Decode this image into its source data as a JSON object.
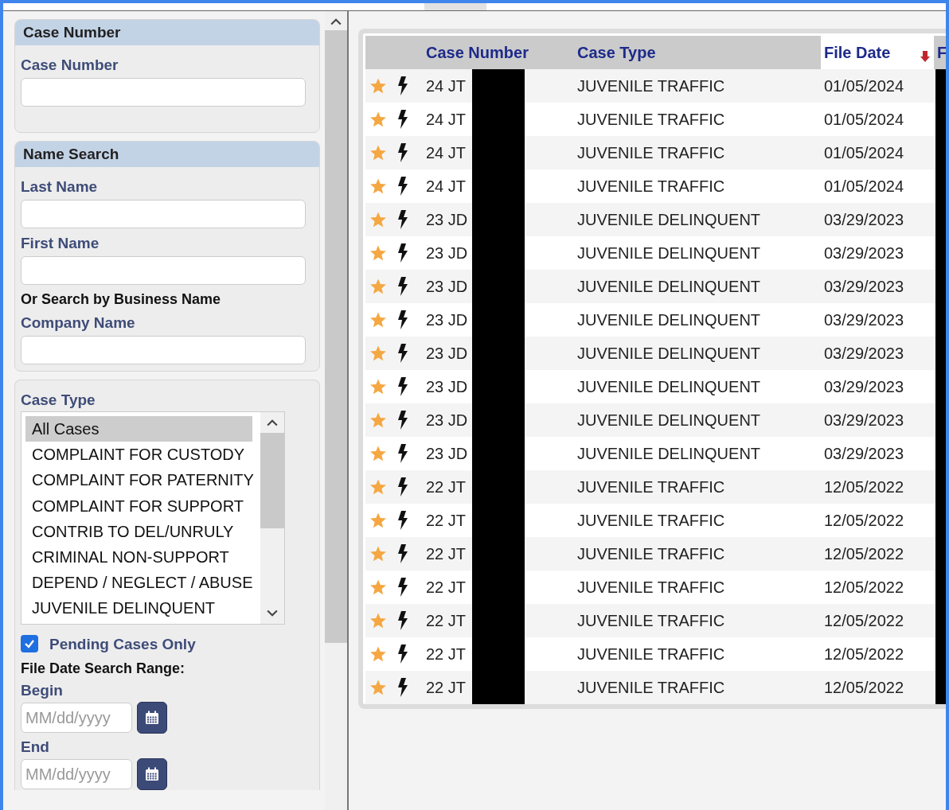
{
  "case_number_section": {
    "title": "Case Number",
    "label": "Case Number"
  },
  "name_search_section": {
    "title": "Name Search",
    "last_name_label": "Last Name",
    "first_name_label": "First Name",
    "business_heading": "Or Search by Business Name",
    "company_label": "Company Name"
  },
  "case_type_section": {
    "label": "Case Type",
    "options": [
      {
        "label": "All Cases",
        "selected": true
      },
      {
        "label": "COMPLAINT FOR CUSTODY",
        "selected": false
      },
      {
        "label": "COMPLAINT FOR PATERNITY",
        "selected": false
      },
      {
        "label": "COMPLAINT FOR SUPPORT",
        "selected": false
      },
      {
        "label": "CONTRIB TO DEL/UNRULY",
        "selected": false
      },
      {
        "label": "CRIMINAL NON-SUPPORT",
        "selected": false
      },
      {
        "label": "DEPEND / NEGLECT / ABUSE",
        "selected": false
      },
      {
        "label": "JUVENILE DELINQUENT",
        "selected": false
      }
    ],
    "pending_only": {
      "label": "Pending Cases Only",
      "checked": true
    },
    "date_range_heading": "File Date Search Range:",
    "begin": {
      "label": "Begin",
      "placeholder": "MM/dd/yyyy"
    },
    "end": {
      "label": "End",
      "placeholder": "MM/dd/yyyy"
    }
  },
  "table": {
    "columns": [
      {
        "label": "Case Number",
        "sorted": false
      },
      {
        "label": "Case Type",
        "sorted": false
      },
      {
        "label": "File Date",
        "sorted": true
      },
      {
        "label": "F",
        "sorted": false
      }
    ],
    "rows": [
      {
        "case_number": "24 JT",
        "case_type": "JUVENILE TRAFFIC",
        "file_date": "01/05/2024"
      },
      {
        "case_number": "24 JT",
        "case_type": "JUVENILE TRAFFIC",
        "file_date": "01/05/2024"
      },
      {
        "case_number": "24 JT",
        "case_type": "JUVENILE TRAFFIC",
        "file_date": "01/05/2024"
      },
      {
        "case_number": "24 JT",
        "case_type": "JUVENILE TRAFFIC",
        "file_date": "01/05/2024"
      },
      {
        "case_number": "23 JD",
        "case_type": "JUVENILE DELINQUENT",
        "file_date": "03/29/2023"
      },
      {
        "case_number": "23 JD",
        "case_type": "JUVENILE DELINQUENT",
        "file_date": "03/29/2023"
      },
      {
        "case_number": "23 JD",
        "case_type": "JUVENILE DELINQUENT",
        "file_date": "03/29/2023"
      },
      {
        "case_number": "23 JD",
        "case_type": "JUVENILE DELINQUENT",
        "file_date": "03/29/2023"
      },
      {
        "case_number": "23 JD",
        "case_type": "JUVENILE DELINQUENT",
        "file_date": "03/29/2023"
      },
      {
        "case_number": "23 JD",
        "case_type": "JUVENILE DELINQUENT",
        "file_date": "03/29/2023"
      },
      {
        "case_number": "23 JD",
        "case_type": "JUVENILE DELINQUENT",
        "file_date": "03/29/2023"
      },
      {
        "case_number": "23 JD",
        "case_type": "JUVENILE DELINQUENT",
        "file_date": "03/29/2023"
      },
      {
        "case_number": "22 JT",
        "case_type": "JUVENILE TRAFFIC",
        "file_date": "12/05/2022"
      },
      {
        "case_number": "22 JT",
        "case_type": "JUVENILE TRAFFIC",
        "file_date": "12/05/2022"
      },
      {
        "case_number": "22 JT",
        "case_type": "JUVENILE TRAFFIC",
        "file_date": "12/05/2022"
      },
      {
        "case_number": "22 JT",
        "case_type": "JUVENILE TRAFFIC",
        "file_date": "12/05/2022"
      },
      {
        "case_number": "22 JT",
        "case_type": "JUVENILE TRAFFIC",
        "file_date": "12/05/2022"
      },
      {
        "case_number": "22 JT",
        "case_type": "JUVENILE TRAFFIC",
        "file_date": "12/05/2022"
      },
      {
        "case_number": "22 JT",
        "case_type": "JUVENILE TRAFFIC",
        "file_date": "12/05/2022"
      }
    ]
  }
}
